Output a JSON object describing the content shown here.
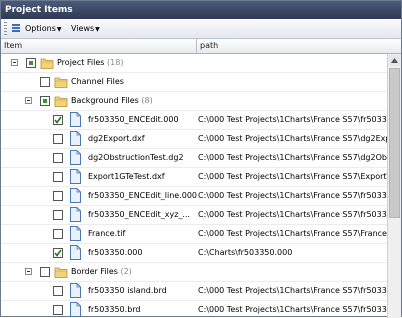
{
  "window": {
    "title": "Project Items"
  },
  "toolbar": {
    "options_label": "Options",
    "views_label": "Views"
  },
  "columns": {
    "item": "Item",
    "path": "path"
  },
  "rows": [
    {
      "kind": "folder",
      "level": 0,
      "expander": true,
      "check": "partial",
      "label": "Project Files",
      "count": "(18)",
      "path": ""
    },
    {
      "kind": "folder",
      "level": 1,
      "expander": false,
      "check": "none",
      "label": "Channel Files",
      "count": "",
      "path": ""
    },
    {
      "kind": "folder",
      "level": 1,
      "expander": true,
      "check": "partial",
      "label": "Background Files",
      "count": "(8)",
      "path": ""
    },
    {
      "kind": "file",
      "level": 2,
      "check": "checked",
      "label": "fr503350_ENCEdit.000",
      "count": "",
      "path": "C:\\000 Test Projects\\1Charts\\France S57\\fr50335"
    },
    {
      "kind": "file",
      "level": 2,
      "check": "none",
      "label": "dg2Export.dxf",
      "count": "",
      "path": "C:\\000 Test Projects\\1Charts\\France S57\\dg2Expo"
    },
    {
      "kind": "file",
      "level": 2,
      "check": "none",
      "label": "dg2ObstructionTest.dg2",
      "count": "",
      "path": "C:\\000 Test Projects\\1Charts\\France S57\\dg2Obs"
    },
    {
      "kind": "file",
      "level": 2,
      "check": "none",
      "label": "Export1GTeTest.dxf",
      "count": "",
      "path": "C:\\000 Test Projects\\1Charts\\France S57\\ExportT"
    },
    {
      "kind": "file",
      "level": 2,
      "check": "none",
      "label": "fr503350_ENCEdit_line.000",
      "count": "",
      "path": "C:\\000 Test Projects\\1Charts\\France S57\\fr50335"
    },
    {
      "kind": "file",
      "level": 2,
      "check": "none",
      "label": "fr503350_ENCEdit_xyz_...",
      "count": "",
      "path": "C:\\000 Test Projects\\1Charts\\France S57\\fr50335"
    },
    {
      "kind": "file",
      "level": 2,
      "check": "none",
      "label": "France.tif",
      "count": "",
      "path": "C:\\000 Test Projects\\1Charts\\France S57\\France."
    },
    {
      "kind": "file",
      "level": 2,
      "check": "checked",
      "label": "fr503350.000",
      "count": "",
      "path": "C:\\Charts\\fr503350.000"
    },
    {
      "kind": "folder",
      "level": 1,
      "expander": true,
      "check": "none",
      "label": "Border Files",
      "count": "(2)",
      "path": ""
    },
    {
      "kind": "file",
      "level": 2,
      "check": "none",
      "label": "fr503350 island.brd",
      "count": "",
      "path": "C:\\000 Test Projects\\1Charts\\France S57\\fr50335"
    },
    {
      "kind": "file",
      "level": 2,
      "check": "none",
      "label": "fr503350.brd",
      "count": "",
      "path": "C:\\000 Test Projects\\1Charts\\France S57\\fr50335"
    }
  ]
}
